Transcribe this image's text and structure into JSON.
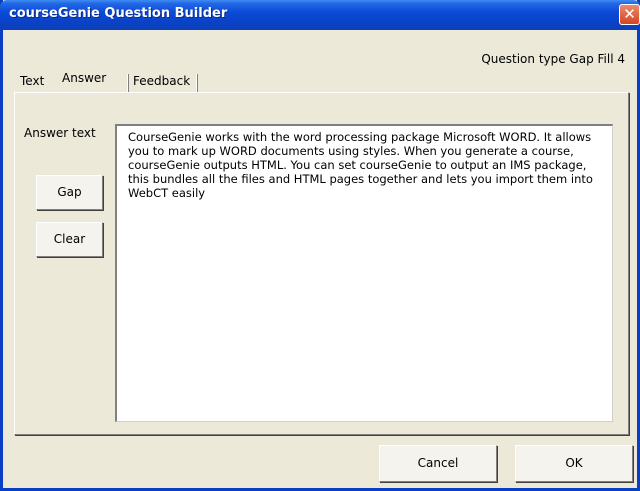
{
  "window": {
    "title": "courseGenie Question Builder",
    "close_glyph": "✕"
  },
  "question_type": "Question type Gap Fill 4",
  "tabs": [
    {
      "label": "Text",
      "active": false
    },
    {
      "label": "Answer",
      "active": true
    },
    {
      "label": "Feedback",
      "active": false
    }
  ],
  "answer": {
    "label": "Answer text",
    "text": "CourseGenie works with the word processing package Microsoft WORD. It allows you to mark up WORD documents using styles. When you generate a course, courseGenie outputs HTML. You can set courseGenie to output an IMS package, this bundles all the files and HTML pages together and lets you import them into WebCT easily",
    "gap_button": "Gap",
    "clear_button": "Clear"
  },
  "footer": {
    "cancel_button": "Cancel",
    "ok_button": "OK"
  },
  "icons": {
    "close": "close-icon"
  },
  "colors": {
    "titlebar": "#0a4bd8",
    "close_button": "#d7441f",
    "dialog_bg": "#ece9d8"
  }
}
